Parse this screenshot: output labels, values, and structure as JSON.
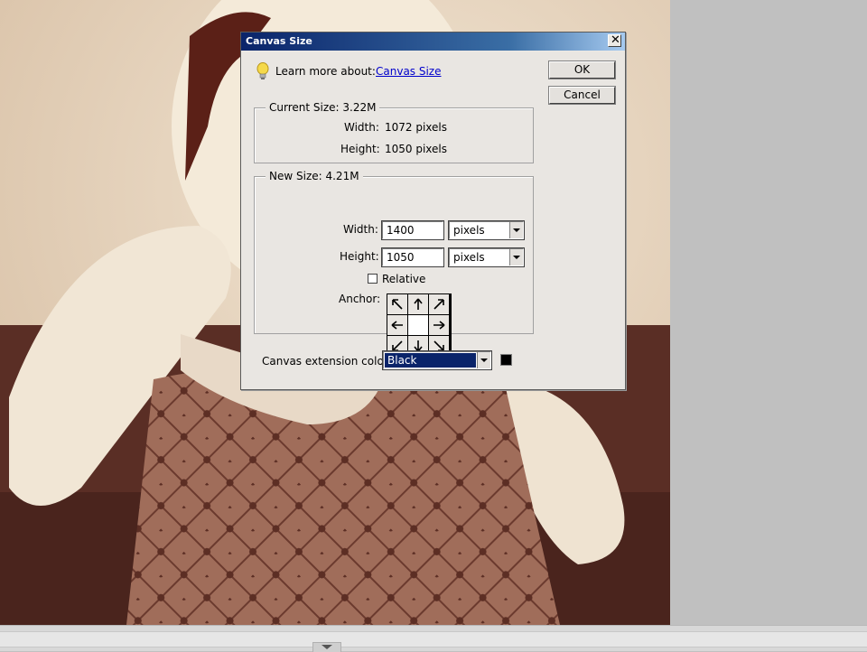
{
  "dialog": {
    "title": "Canvas Size",
    "learn_more_label": "Learn more about:",
    "learn_more_link": "Canvas Size",
    "ok_label": "OK",
    "cancel_label": "Cancel",
    "current_size": {
      "title": "Current Size: 3.22M",
      "width_label": "Width:",
      "width_value": "1072 pixels",
      "height_label": "Height:",
      "height_value": "1050 pixels"
    },
    "new_size": {
      "title": "New Size: 4.21M",
      "width_label": "Width:",
      "width_value": "1400",
      "width_unit": "pixels",
      "height_label": "Height:",
      "height_value": "1050",
      "height_unit": "pixels",
      "relative_label": "Relative",
      "relative_checked": false,
      "anchor_label": "Anchor:",
      "anchor_selected": "center"
    },
    "extension_color_label": "Canvas extension color:",
    "extension_color_value": "Black",
    "extension_color_hex": "#000000"
  },
  "colors": {
    "titlebar_start": "#0a246a",
    "titlebar_end": "#a6caf0",
    "select_highlight": "#0a246a",
    "dialog_bg": "#e9e6e2"
  }
}
